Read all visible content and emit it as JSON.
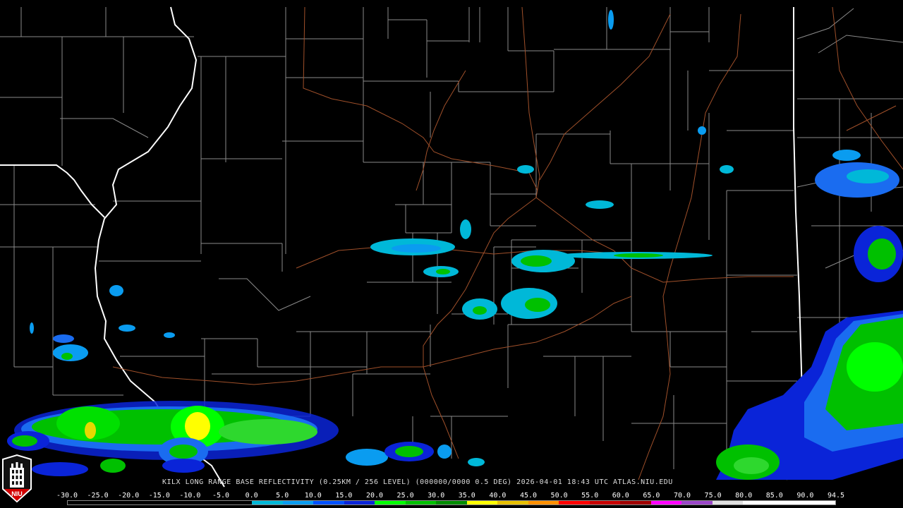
{
  "caption": "KILX LONG RANGE BASE REFLECTIVITY (0.25KM / 256 LEVEL) (000000/0000 0.5 DEG) 2026-04-01 18:43 UTC  ATLAS.NIU.EDU",
  "logo": {
    "label": "NIU"
  },
  "scale": {
    "ticks": [
      "-30.0",
      "-25.0",
      "-20.0",
      "-15.0",
      "-10.0",
      "-5.0",
      "0.0",
      "5.0",
      "10.0",
      "15.0",
      "20.0",
      "25.0",
      "30.0",
      "35.0",
      "40.0",
      "45.0",
      "50.0",
      "55.0",
      "60.0",
      "65.0",
      "70.0",
      "75.0",
      "80.0",
      "85.0",
      "90.0",
      "94.5"
    ],
    "colors": [
      "#000000",
      "#000000",
      "#000000",
      "#000000",
      "#000000",
      "#000000",
      "#00b8d8",
      "#0a9cf0",
      "#0050ff",
      "#0a24d8",
      "#00ff00",
      "#00c000",
      "#008c00",
      "#ffff00",
      "#e8c000",
      "#ff9000",
      "#ff0000",
      "#c80000",
      "#a00000",
      "#ff00ff",
      "#9a46c8",
      "#e0e0e0",
      "#ffffff",
      "#ffffff",
      "#ffffff"
    ]
  },
  "colors": {
    "county": "#9a9a9a",
    "state": "#ffffff",
    "road": "#a0502a"
  }
}
